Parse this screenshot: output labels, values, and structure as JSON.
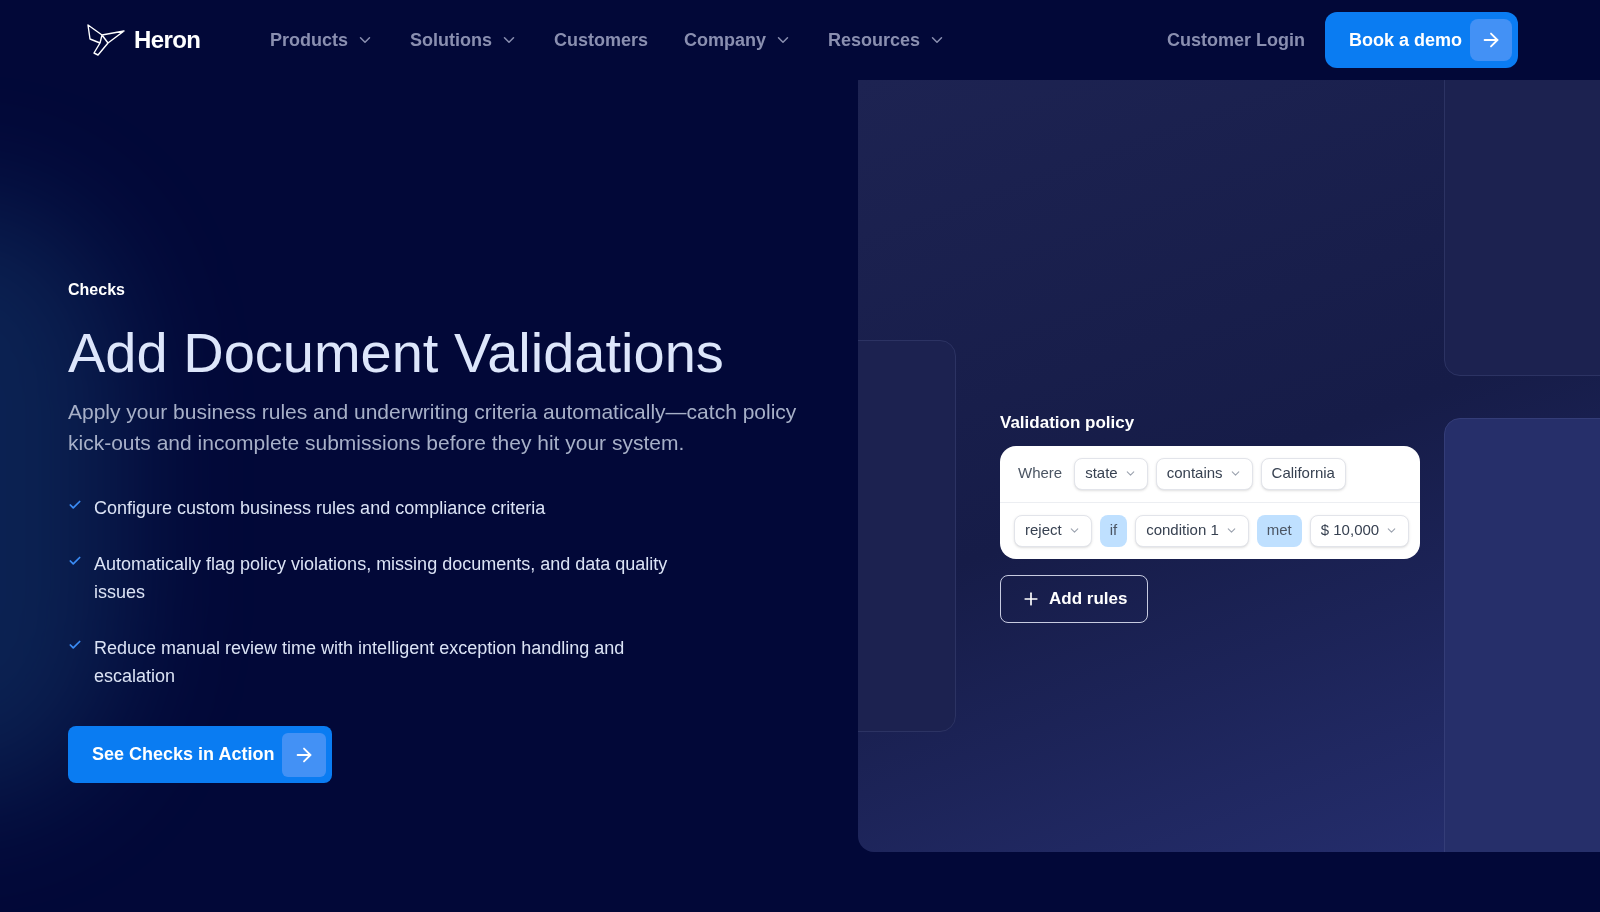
{
  "nav": {
    "brand": "Heron",
    "items": [
      {
        "label": "Products",
        "dropdown": true
      },
      {
        "label": "Solutions",
        "dropdown": true
      },
      {
        "label": "Customers",
        "dropdown": false
      },
      {
        "label": "Company",
        "dropdown": true
      },
      {
        "label": "Resources",
        "dropdown": true
      }
    ],
    "login": "Customer Login",
    "cta": "Book a demo"
  },
  "hero": {
    "eyebrow": "Checks",
    "title": "Add Document Validations",
    "lead": "Apply your business rules and underwriting criteria automatically—catch policy kick-outs and incomplete submissions before they hit your system.",
    "bullets": [
      "Configure custom business rules and compliance criteria",
      "Automatically flag policy violations, missing documents, and data quality issues",
      "Reduce manual review time with intelligent exception handling and escalation"
    ],
    "cta": "See Checks in Action"
  },
  "policy": {
    "title": "Validation policy",
    "rows": [
      [
        {
          "kind": "text",
          "label": "Where"
        },
        {
          "kind": "select",
          "label": "state"
        },
        {
          "kind": "select",
          "label": "contains"
        },
        {
          "kind": "value",
          "label": "California"
        }
      ],
      [
        {
          "kind": "select",
          "label": "reject"
        },
        {
          "kind": "keyword",
          "label": "if"
        },
        {
          "kind": "select",
          "label": "condition 1"
        },
        {
          "kind": "keyword",
          "label": "met"
        },
        {
          "kind": "select",
          "label": "$ 10,000"
        }
      ]
    ],
    "add": "Add rules"
  }
}
